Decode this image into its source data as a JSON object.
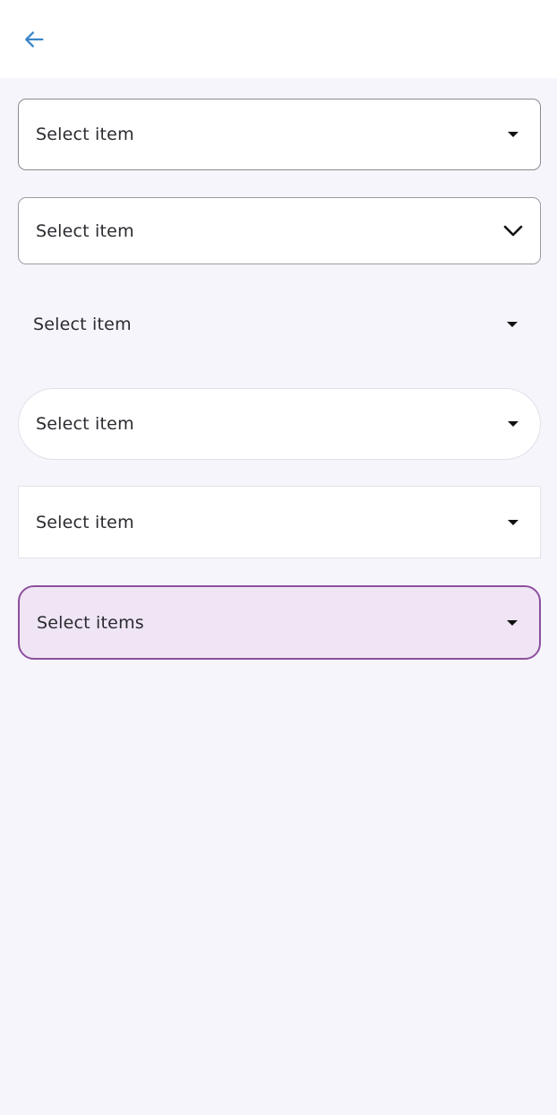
{
  "app": {
    "back_icon": "arrow-left-icon",
    "accent_color": "#3a86c8"
  },
  "selects": [
    {
      "label": "Select item",
      "icon": "caret-down-icon"
    },
    {
      "label": "Select item",
      "icon": "chevron-down-icon"
    },
    {
      "label": "Select item",
      "icon": "caret-down-icon"
    },
    {
      "label": "Select item",
      "icon": "caret-down-icon"
    },
    {
      "label": "Select item",
      "icon": "caret-down-icon"
    },
    {
      "label": "Select items",
      "icon": "caret-down-icon",
      "fill_color": "#f0e5f4",
      "border_color": "#8c4f9f"
    }
  ]
}
